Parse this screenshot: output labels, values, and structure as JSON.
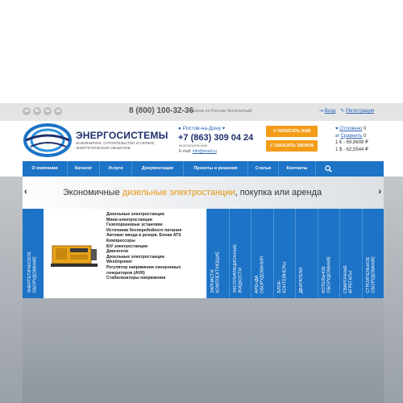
{
  "topbar": {
    "social": [
      "vk",
      "fb",
      "tw",
      "ok"
    ],
    "phone": "8 (800) 100-32-36",
    "phone_note": "звонок по России бесплатный",
    "login": "Вход",
    "register": "Регистрация"
  },
  "header": {
    "logo_title": "ЭНЕРГОСИСТЕМЫ",
    "logo_subtitle": "инжиниринг, строительство и сервис энергетических объектов",
    "city": "Ростов-на-Дону",
    "phone": "+7 (863) 309 04 24",
    "multichannel": "многоканальный",
    "email_label": "E-mail:",
    "email": "info@ensd.ru",
    "write_button": "НАПИСАТЬ НАМ",
    "call_button": "ЗАКАЗАТЬ ЗВОНОК",
    "deferred_label": "Отложено",
    "deferred_count": "0",
    "compare_label": "Сравнить",
    "compare_count": "0",
    "rate_eur": "1 € - 69,8608 ₽",
    "rate_usd": "1 $ - 62,5544 ₽"
  },
  "nav": {
    "items": [
      "О компании",
      "Каталог",
      "Услуги",
      "Документация",
      "Проекты и решения",
      "Статьи",
      "Контакты"
    ],
    "search_icon": "magnifier"
  },
  "banner": {
    "text_before": "Экономичные ",
    "text_highlight": "дизельные электростанции",
    "text_after": ", покупка или аренда",
    "prev": "‹",
    "next": "›"
  },
  "catalog": {
    "left_label": "Энергетическое\nоборудование",
    "items": [
      "Дизельные электростанции",
      "Мини-электростанции",
      "Газопоршневые установки",
      "Источники бесперебойного питания",
      "Автомат ввода в резерв. Блоки ATS",
      "Компрессоры",
      "Б/У электростанции",
      "Двигатели",
      "Дизельные электростанции\nWestinpower",
      "Регулятор напряжения синхронных\nгенераторов (AVR)",
      "Стабилизаторы напряжения"
    ],
    "columns": [
      "Запчасти\nкомплектующие",
      "Эксплуатационные\nжидкости",
      "Аренда\nоборудования",
      "Блок-\nконтейнеры",
      "Двигатели",
      "Котельное\nоборудование",
      "Сварочные\nагрегаты",
      "Строительное\nоборудование"
    ]
  }
}
